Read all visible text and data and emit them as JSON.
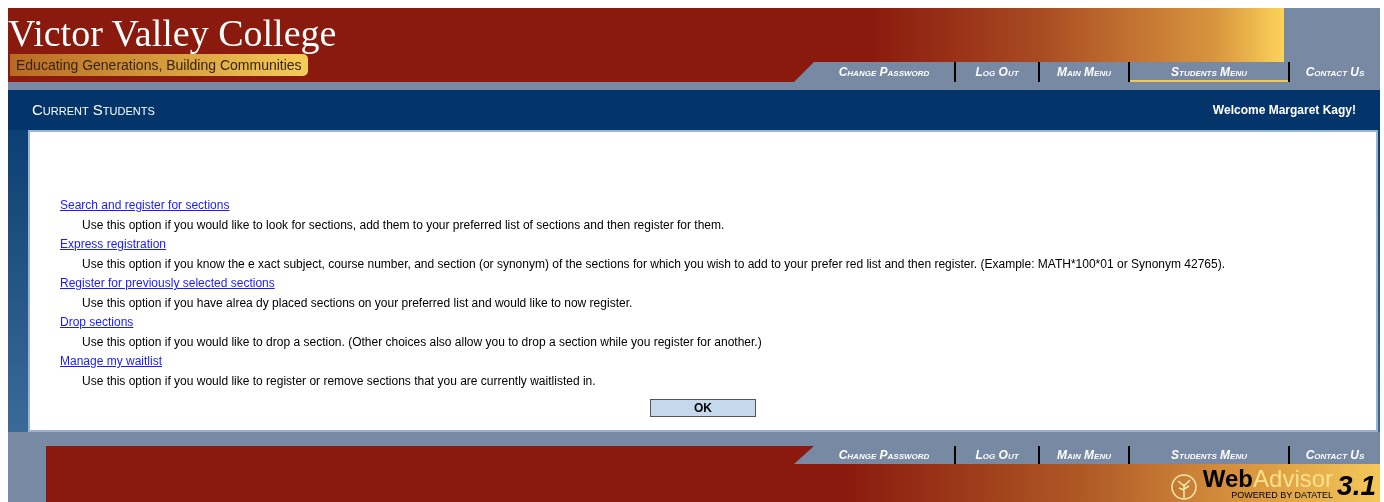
{
  "header": {
    "title": "Victor Valley College",
    "tagline": "Educating Generations, Building Communities"
  },
  "top_nav": [
    {
      "label": "Change Password",
      "selected": false
    },
    {
      "label": "Log Out",
      "selected": false
    },
    {
      "label": "Main Menu",
      "selected": false
    },
    {
      "label": "Students Menu",
      "selected": true
    },
    {
      "label": "Contact Us",
      "selected": false
    }
  ],
  "section_title": "Current Students",
  "welcome": "Welcome Margaret Kagy!",
  "options": [
    {
      "link": "Search and register for sections",
      "description": "Use this option if you would like to look for sections, add them to your preferred list of sections and then register for them."
    },
    {
      "link": "Express registration",
      "description": "Use this option if you know the e xact subject, course number, and section (or synonym) of the sections for which you wish to add to your prefer red list and then register. (Example: MATH*100*01 or Synonym 42765)."
    },
    {
      "link": "Register for previously selected sections",
      "description": "Use this option if you have alrea dy placed sections on your preferred list and would like to now register."
    },
    {
      "link": "Drop sections",
      "description": "Use this option if you would like to drop a section. (Other choices also allow you to drop a section while you register for another.)"
    },
    {
      "link": "Manage my waitlist",
      "description": "Use this option if you would like to register or remove sections that you are currently waitlisted in."
    }
  ],
  "ok_button": "OK",
  "footer_nav": [
    "Change Password",
    "Log Out",
    "Main Menu",
    "Students Menu",
    "Contact Us"
  ],
  "footer_logo": {
    "word_1": "Web",
    "word_2": "Advisor",
    "version": "3.1",
    "tagline": "POWERED BY DATATEL"
  }
}
